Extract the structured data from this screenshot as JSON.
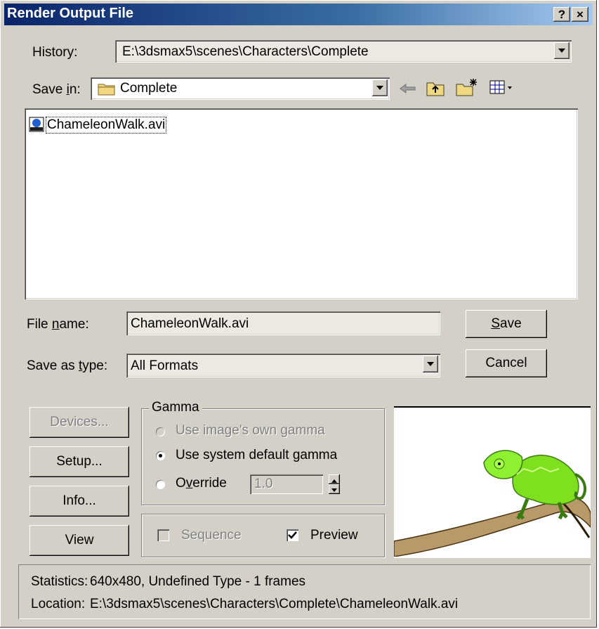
{
  "window": {
    "title": "Render Output File",
    "help_label": "?",
    "close_label": "×"
  },
  "history": {
    "label": "History:",
    "value": "E:\\3dsmax5\\scenes\\Characters\\Complete"
  },
  "save_in": {
    "label_pre": "Save ",
    "label_ul": "i",
    "label_post": "n:",
    "value": "Complete"
  },
  "files": [
    {
      "name": "ChameleonWalk.avi",
      "icon": "avi-file-icon"
    }
  ],
  "file_name": {
    "label_pre": "File ",
    "label_ul": "n",
    "label_post": "ame:",
    "value": "ChameleonWalk.avi"
  },
  "save_type": {
    "label_pre": "Save as ",
    "label_ul": "t",
    "label_post": "ype:",
    "value": "All Formats"
  },
  "buttons": {
    "save_ul": "S",
    "save_rest": "ave",
    "cancel": "Cancel",
    "devices": "Devices...",
    "setup": "Setup...",
    "info": "Info...",
    "view": "View"
  },
  "gamma": {
    "legend": "Gamma",
    "own": "Use image's own gamma",
    "system": "Use system default gamma",
    "override_pre": "O",
    "override_ul": "v",
    "override_post": "erride",
    "override_value": "1.0",
    "selected": "system"
  },
  "options": {
    "sequence": "Sequence",
    "sequence_checked": false,
    "preview": "Preview",
    "preview_checked": true
  },
  "stats": {
    "statistics_label": "Statistics:",
    "statistics_value": "640x480, Undefined Type - 1 frames",
    "location_label": "Location:",
    "location_value": "E:\\3dsmax5\\scenes\\Characters\\Complete\\ChameleonWalk.avi"
  },
  "colors": {
    "titlebar": "#0a246a",
    "face": "#d4d0c8",
    "chameleon": "#7fe020"
  }
}
